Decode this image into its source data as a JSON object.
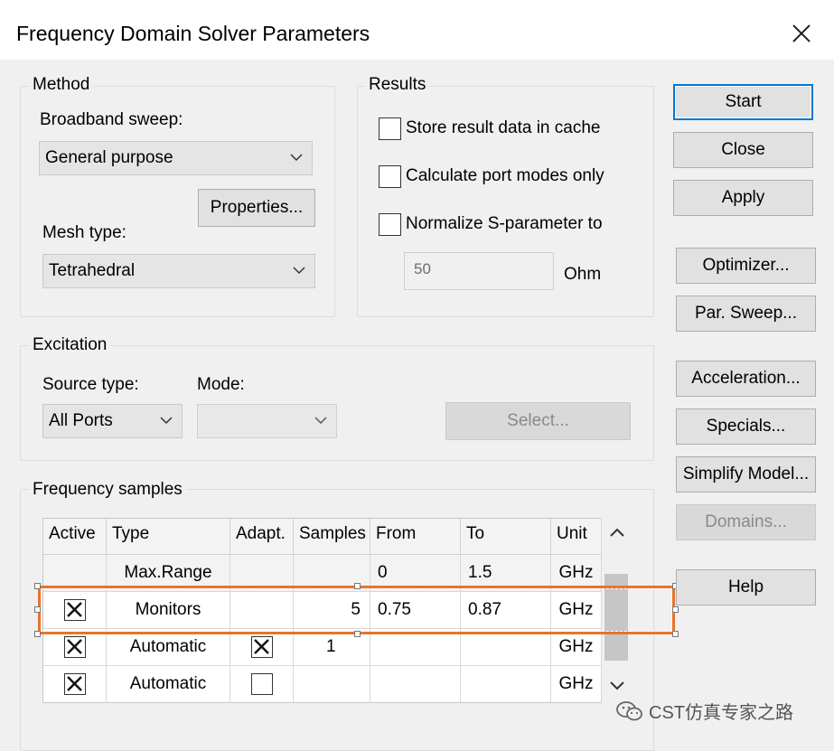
{
  "window": {
    "title": "Frequency Domain Solver Parameters"
  },
  "method": {
    "group_label": "Method",
    "broadband_label": "Broadband sweep:",
    "broadband_value": "General purpose",
    "properties_button": "Properties...",
    "mesh_label": "Mesh type:",
    "mesh_value": "Tetrahedral"
  },
  "results": {
    "group_label": "Results",
    "store_cache": "Store result data in cache",
    "port_modes": "Calculate port modes only",
    "normalize": "Normalize S-parameter to",
    "normalize_value": "50",
    "unit": "Ohm"
  },
  "excitation": {
    "group_label": "Excitation",
    "source_label": "Source type:",
    "source_value": "All Ports",
    "mode_label": "Mode:",
    "mode_value": "",
    "select_button": "Select..."
  },
  "frequency_samples": {
    "group_label": "Frequency samples",
    "columns": [
      "Active",
      "Type",
      "Adapt.",
      "Samples",
      "From",
      "To",
      "Unit"
    ],
    "rows": [
      {
        "active": null,
        "type": "Max.Range",
        "adapt": null,
        "samples": "",
        "from": "0",
        "to": "1.5",
        "unit": "GHz"
      },
      {
        "active": true,
        "type": "Monitors",
        "adapt": null,
        "samples": "5",
        "from": "0.75",
        "to": "0.87",
        "unit": "GHz"
      },
      {
        "active": true,
        "type": "Automatic",
        "adapt": true,
        "samples": "1",
        "from": "",
        "to": "",
        "unit": "GHz"
      },
      {
        "active": true,
        "type": "Automatic",
        "adapt": false,
        "samples": "",
        "from": "",
        "to": "",
        "unit": "GHz"
      }
    ]
  },
  "buttons": {
    "start": "Start",
    "close": "Close",
    "apply": "Apply",
    "optimizer": "Optimizer...",
    "par_sweep": "Par. Sweep...",
    "acceleration": "Acceleration...",
    "specials": "Specials...",
    "simplify": "Simplify Model...",
    "domains": "Domains...",
    "help": "Help"
  },
  "watermark": "CST仿真专家之路",
  "colors": {
    "accent": "#0078d7",
    "highlight": "#e8742a"
  },
  "icons": [
    "close-icon",
    "chevron-down-icon",
    "scroll-up-icon",
    "scroll-down-icon",
    "wechat-icon"
  ]
}
